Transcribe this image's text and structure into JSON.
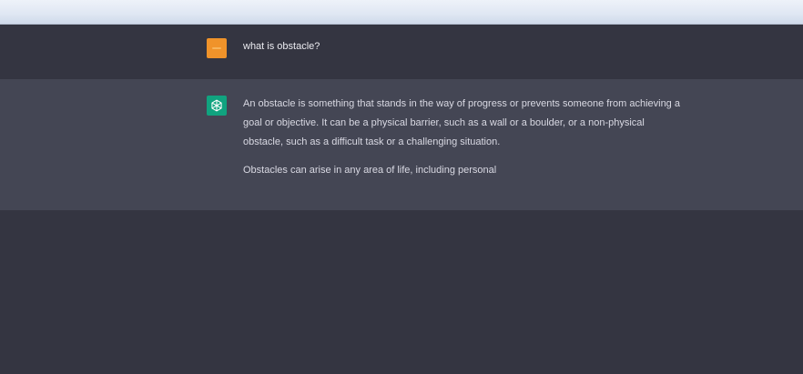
{
  "conversation": {
    "user_message": "what is obstacle?",
    "assistant_paragraphs": [
      "An obstacle is something that stands in the way of progress or prevents someone from achieving a goal or objective. It can be a physical barrier, such as a wall or a boulder, or a non-physical obstacle, such as a difficult task or a challenging situation.",
      "Obstacles can arise in any area of life, including personal"
    ],
    "user_avatar_color": "#f0932a",
    "assistant_avatar_color": "#10a37f",
    "assistant_avatar_icon": "openai-logo-icon"
  },
  "colors": {
    "background": "#343541",
    "assistant_row": "#444654",
    "text": "#ececf1"
  }
}
